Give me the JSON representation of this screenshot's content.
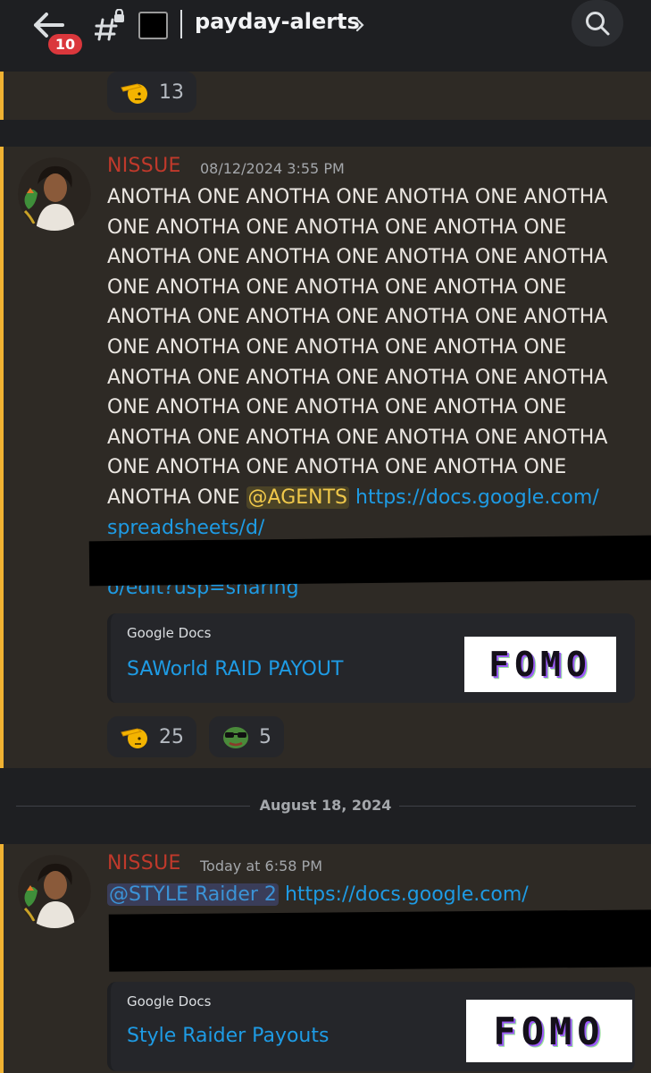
{
  "header": {
    "unread_count": "10",
    "channel_name": "payday-alerts",
    "icons": [
      "back-arrow-icon",
      "hash-lock-icon",
      "black-square-emoji-icon",
      "chevron-right-icon",
      "search-icon"
    ]
  },
  "top_reaction": {
    "emoji": "saluting-face",
    "count": "13"
  },
  "messages": [
    {
      "author": "NISSUE",
      "timestamp": "08/12/2024 3:55 PM",
      "text_lines": [
        "ANOTHA ONE ANOTHA ONE ANOTHA ONE ANOTHA",
        "ONE ANOTHA ONE ANOTHA ONE ANOTHA ONE",
        "ANOTHA ONE ANOTHA ONE ANOTHA ONE ANOTHA",
        "ONE ANOTHA ONE ANOTHA ONE ANOTHA ONE",
        "ANOTHA ONE ANOTHA ONE ANOTHA ONE ANOTHA",
        "ONE ANOTHA ONE ANOTHA ONE ANOTHA ONE",
        "ANOTHA ONE ANOTHA ONE ANOTHA ONE ANOTHA",
        "ONE ANOTHA ONE ANOTHA ONE ANOTHA ONE",
        "ANOTHA ONE ANOTHA ONE ANOTHA ONE ANOTHA",
        "ONE ANOTHA ONE ANOTHA ONE ANOTHA ONE"
      ],
      "last_line_prefix": "ANOTHA ONE",
      "mention": "@AGENTS",
      "link_part1": "https://docs.google.com/",
      "link_part2": "spreadsheets/d/",
      "link_part3": "o/edit?usp=sharing",
      "embed": {
        "provider": "Google Docs",
        "title": "SAWorld RAID PAYOUT",
        "thumbnail_text": "FOMO"
      },
      "reactions": [
        {
          "emoji": "saluting-face",
          "count": "25"
        },
        {
          "emoji": "pepe-sunglasses",
          "count": "5"
        }
      ]
    },
    {
      "author": "NISSUE",
      "timestamp": "Today at 6:58 PM",
      "mention": "@STYLE Raider 2",
      "link_part1": "https://docs.google.com/",
      "embed": {
        "provider": "Google Docs",
        "title": "Style Raider Payouts",
        "thumbnail_text": "FOMO"
      }
    }
  ],
  "date_separator": "August 18, 2024",
  "colors": {
    "accent_border": "#f0b232",
    "author": "#c0392b",
    "link": "#1e9be4",
    "mention_text": "#f0c84a",
    "badge": "#da373c"
  }
}
